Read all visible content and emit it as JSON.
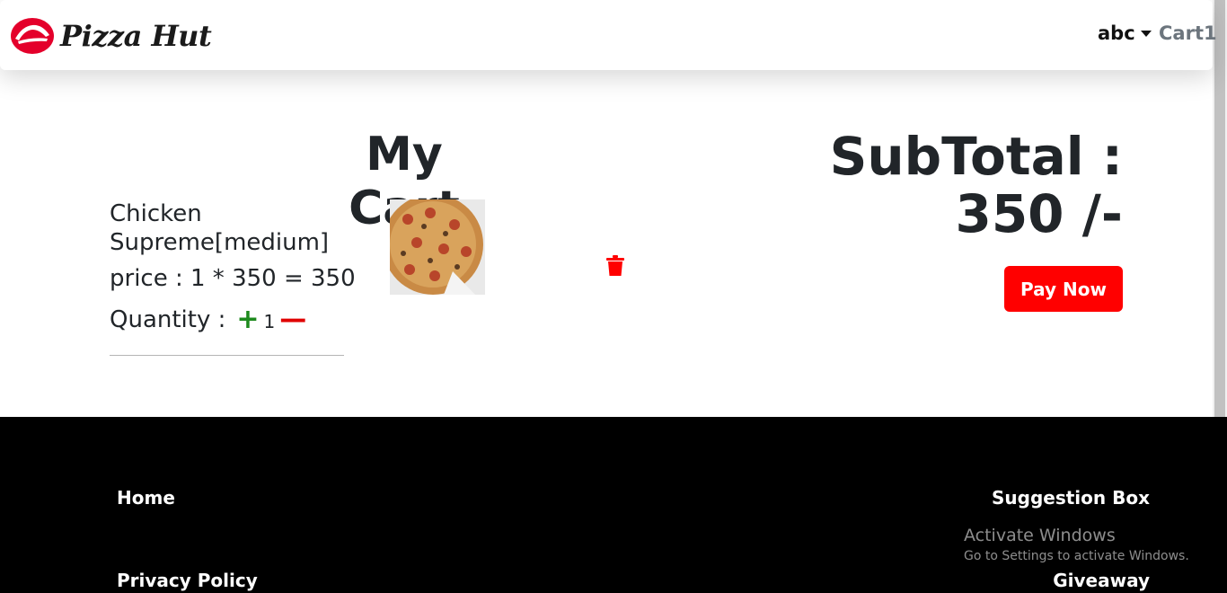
{
  "brand": {
    "name": "Pizza Hut"
  },
  "nav": {
    "user_label": "abc",
    "cart_label": "Cart1"
  },
  "cart": {
    "title": "My Cart",
    "item": {
      "name": "Chicken Supreme[medium]",
      "price_text": "price : 1 * 350 = 350",
      "quantity_label": "Quantity :",
      "plus_symbol": "+",
      "quantity": "1",
      "minus_symbol": "—"
    },
    "subtotal_text": "SubTotal : 350 /-",
    "pay_label": "Pay Now"
  },
  "footer": {
    "home": "Home",
    "privacy": "Privacy Policy",
    "suggestion": "Suggestion Box",
    "giveaway": "Giveaway"
  },
  "watermark": {
    "title": "Activate Windows",
    "subtitle": "Go to Settings to activate Windows."
  },
  "colors": {
    "accent": "#ff0000",
    "plus": "#1d8a1d",
    "footer_bg": "#000000"
  }
}
